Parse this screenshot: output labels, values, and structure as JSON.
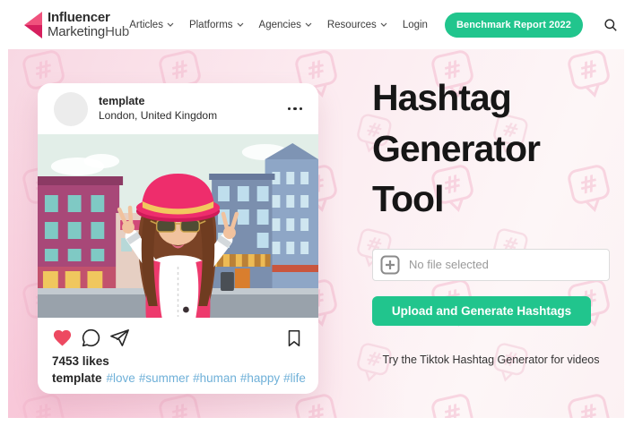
{
  "header": {
    "logo": {
      "line1": "Influencer",
      "line2_bold": "Marketing",
      "line2_light": "Hub"
    },
    "nav": [
      {
        "label": "Articles"
      },
      {
        "label": "Platforms"
      },
      {
        "label": "Agencies"
      },
      {
        "label": "Resources"
      }
    ],
    "login_label": "Login",
    "cta_label": "Benchmark Report 2022"
  },
  "hero": {
    "title_lines": [
      "Hashtag",
      "Generator",
      "Tool"
    ],
    "file_input": {
      "value": "No file selected"
    },
    "upload_button_label": "Upload and Generate Hashtags",
    "note": "Try the Tiktok Hashtag Generator for videos"
  },
  "post_card": {
    "username": "template",
    "location": "London, United Kingdom",
    "likes": "7453 likes",
    "caption_username": "template",
    "hashtags": [
      "#love",
      "#summer",
      "#human",
      "#happy",
      "#life"
    ]
  },
  "icons": {
    "logo_mark": "brand-arrow-icon",
    "nav_chevron": "chevron-down-icon",
    "search": "search-icon",
    "card_menu": "more-options-icon",
    "like": "heart-icon",
    "comment": "comment-icon",
    "share": "share-icon",
    "save": "bookmark-icon",
    "add_file": "plus-icon"
  },
  "colors": {
    "accent_green": "#21c58d",
    "brand_pink": "#e8336e",
    "hashtag_blue": "#6fb0d8",
    "heart_red": "#ed4961",
    "hero_pink": "#f8d8e3"
  }
}
